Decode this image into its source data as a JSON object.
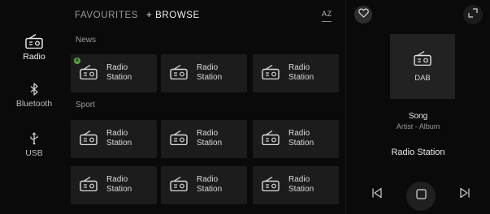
{
  "sidebar": {
    "items": [
      {
        "label": "Radio",
        "icon": "radio-icon",
        "active": true
      },
      {
        "label": "Bluetooth",
        "icon": "bluetooth-icon",
        "active": false
      },
      {
        "label": "USB",
        "icon": "usb-icon",
        "active": false
      }
    ]
  },
  "header": {
    "tabs": [
      {
        "label": "FAVOURITES"
      },
      {
        "label": "+ BROWSE"
      }
    ],
    "sort_label": "AZ"
  },
  "sections": [
    {
      "title": "News",
      "tiles": [
        {
          "line1": "Radio",
          "line2": "Station",
          "badge": "A"
        },
        {
          "line1": "Radio",
          "line2": "Station"
        },
        {
          "line1": "Radio",
          "line2": "Station"
        }
      ]
    },
    {
      "title": "Sport",
      "tiles": [
        {
          "line1": "Radio",
          "line2": "Station"
        },
        {
          "line1": "Radio",
          "line2": "Station"
        },
        {
          "line1": "Radio",
          "line2": "Station"
        },
        {
          "line1": "Radio",
          "line2": "Station"
        },
        {
          "line1": "Radio",
          "line2": "Station"
        },
        {
          "line1": "Radio",
          "line2": "Station"
        }
      ]
    }
  ],
  "now_playing": {
    "source_label": "DAB",
    "song": "Song",
    "artist_album": "Artist - Album",
    "station": "Radio Station"
  },
  "colors": {
    "background": "#0a0a0a",
    "tile": "#1c1c1c",
    "badge": "#5da34f"
  }
}
